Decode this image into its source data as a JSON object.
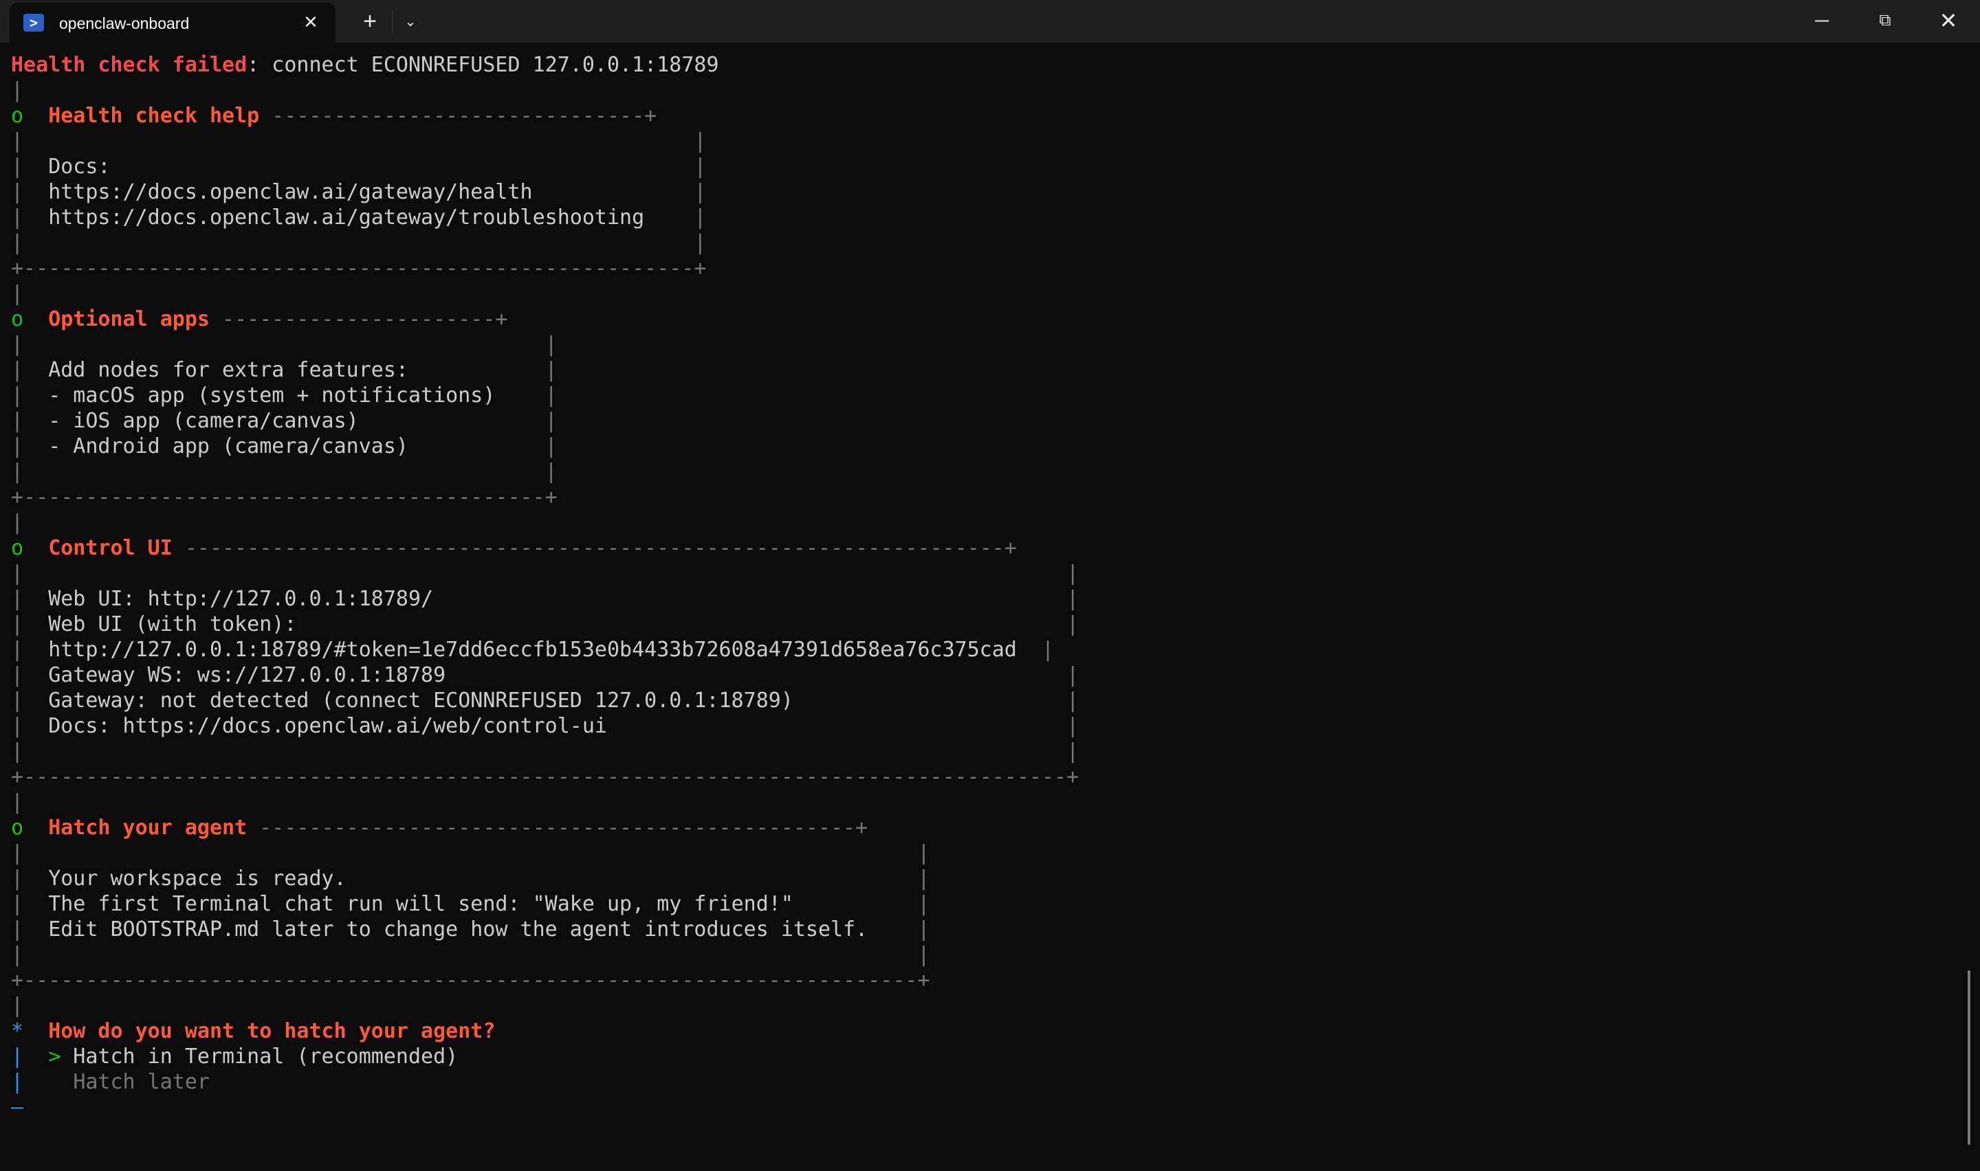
{
  "window": {
    "tab_title": "openclaw-onboard",
    "tab_icon": "powershell-icon",
    "new_tab_glyph": "+",
    "controls": [
      "minimize",
      "maximize",
      "close"
    ]
  },
  "terminal": {
    "lines": [
      [
        {
          "t": "Health check failed",
          "c": "red"
        },
        {
          "t": ": connect ECONNREFUSED 127.0.0.1:18789",
          "c": "white"
        }
      ],
      [
        {
          "t": "|",
          "c": "gray"
        }
      ],
      [
        {
          "t": "o",
          "c": "grn"
        },
        {
          "t": "  ",
          "c": "white"
        },
        {
          "t": "Health check help",
          "c": "orange"
        },
        {
          "t": " ------------------------------+",
          "c": "gray"
        }
      ],
      [
        {
          "t": "|                                                      |",
          "c": "gray"
        }
      ],
      [
        {
          "t": "|  ",
          "c": "gray"
        },
        {
          "t": "Docs:                                               ",
          "c": "white"
        },
        {
          "t": "|",
          "c": "gray"
        }
      ],
      [
        {
          "t": "|  ",
          "c": "gray"
        },
        {
          "t": "https://docs.openclaw.ai/gateway/health             ",
          "c": "white"
        },
        {
          "t": "|",
          "c": "gray"
        }
      ],
      [
        {
          "t": "|  ",
          "c": "gray"
        },
        {
          "t": "https://docs.openclaw.ai/gateway/troubleshooting    ",
          "c": "white"
        },
        {
          "t": "|",
          "c": "gray"
        }
      ],
      [
        {
          "t": "|                                                      |",
          "c": "gray"
        }
      ],
      [
        {
          "t": "+------------------------------------------------------+",
          "c": "gray"
        }
      ],
      [
        {
          "t": "|",
          "c": "gray"
        }
      ],
      [
        {
          "t": "o",
          "c": "grn"
        },
        {
          "t": "  ",
          "c": "white"
        },
        {
          "t": "Optional apps",
          "c": "orange"
        },
        {
          "t": " ----------------------+",
          "c": "gray"
        }
      ],
      [
        {
          "t": "|                                          |",
          "c": "gray"
        }
      ],
      [
        {
          "t": "|  ",
          "c": "gray"
        },
        {
          "t": "Add nodes for extra features:           ",
          "c": "white"
        },
        {
          "t": "|",
          "c": "gray"
        }
      ],
      [
        {
          "t": "|  ",
          "c": "gray"
        },
        {
          "t": "- macOS app (system + notifications)    ",
          "c": "white"
        },
        {
          "t": "|",
          "c": "gray"
        }
      ],
      [
        {
          "t": "|  ",
          "c": "gray"
        },
        {
          "t": "- iOS app (camera/canvas)               ",
          "c": "white"
        },
        {
          "t": "|",
          "c": "gray"
        }
      ],
      [
        {
          "t": "|  ",
          "c": "gray"
        },
        {
          "t": "- Android app (camera/canvas)           ",
          "c": "white"
        },
        {
          "t": "|",
          "c": "gray"
        }
      ],
      [
        {
          "t": "|                                          |",
          "c": "gray"
        }
      ],
      [
        {
          "t": "+------------------------------------------+",
          "c": "gray"
        }
      ],
      [
        {
          "t": "|",
          "c": "gray"
        }
      ],
      [
        {
          "t": "o",
          "c": "grn"
        },
        {
          "t": "  ",
          "c": "white"
        },
        {
          "t": "Control UI",
          "c": "orange"
        },
        {
          "t": " ------------------------------------------------------------------+",
          "c": "gray"
        }
      ],
      [
        {
          "t": "|                                                                                    |",
          "c": "gray"
        }
      ],
      [
        {
          "t": "|  ",
          "c": "gray"
        },
        {
          "t": "Web UI: http://127.0.0.1:18789/                                                   ",
          "c": "white"
        },
        {
          "t": "|",
          "c": "gray"
        }
      ],
      [
        {
          "t": "|  ",
          "c": "gray"
        },
        {
          "t": "Web UI (with token):                                                              ",
          "c": "white"
        },
        {
          "t": "|",
          "c": "gray"
        }
      ],
      [
        {
          "t": "|  ",
          "c": "gray"
        },
        {
          "t": "http://127.0.0.1:18789/#token=1e7dd6eccfb153e0b4433b72608a47391d658ea76c375cad  ",
          "c": "white"
        },
        {
          "t": "|",
          "c": "gray"
        }
      ],
      [
        {
          "t": "|  ",
          "c": "gray"
        },
        {
          "t": "Gateway WS: ws://127.0.0.1:18789                                                  ",
          "c": "white"
        },
        {
          "t": "|",
          "c": "gray"
        }
      ],
      [
        {
          "t": "|  ",
          "c": "gray"
        },
        {
          "t": "Gateway: not detected (connect ECONNREFUSED 127.0.0.1:18789)                      ",
          "c": "white"
        },
        {
          "t": "|",
          "c": "gray"
        }
      ],
      [
        {
          "t": "|  ",
          "c": "gray"
        },
        {
          "t": "Docs: https://docs.openclaw.ai/web/control-ui                                     ",
          "c": "white"
        },
        {
          "t": "|",
          "c": "gray"
        }
      ],
      [
        {
          "t": "|                                                                                    |",
          "c": "gray"
        }
      ],
      [
        {
          "t": "+------------------------------------------------------------------------------------+",
          "c": "gray"
        }
      ],
      [
        {
          "t": "|",
          "c": "gray"
        }
      ],
      [
        {
          "t": "o",
          "c": "grn"
        },
        {
          "t": "  ",
          "c": "white"
        },
        {
          "t": "Hatch your agent",
          "c": "orange"
        },
        {
          "t": " ------------------------------------------------+",
          "c": "gray"
        }
      ],
      [
        {
          "t": "|                                                                        |",
          "c": "gray"
        }
      ],
      [
        {
          "t": "|  ",
          "c": "gray"
        },
        {
          "t": "Your workspace is ready.                                              ",
          "c": "white"
        },
        {
          "t": "|",
          "c": "gray"
        }
      ],
      [
        {
          "t": "|  ",
          "c": "gray"
        },
        {
          "t": "The first Terminal chat run will send: \"Wake up, my friend!\"          ",
          "c": "white"
        },
        {
          "t": "|",
          "c": "gray"
        }
      ],
      [
        {
          "t": "|  ",
          "c": "gray"
        },
        {
          "t": "Edit BOOTSTRAP.md later to change how the agent introduces itself.    ",
          "c": "white"
        },
        {
          "t": "|",
          "c": "gray"
        }
      ],
      [
        {
          "t": "|                                                                        |",
          "c": "gray"
        }
      ],
      [
        {
          "t": "+------------------------------------------------------------------------+",
          "c": "gray"
        }
      ],
      [
        {
          "t": "|",
          "c": "gray"
        }
      ],
      [
        {
          "t": "*",
          "c": "blue"
        },
        {
          "t": "  ",
          "c": "white"
        },
        {
          "t": "How do you want to hatch your agent?",
          "c": "orange"
        }
      ],
      [
        {
          "t": "|",
          "c": "blue"
        },
        {
          "t": "  ",
          "c": "white"
        },
        {
          "t": ">",
          "c": "grn"
        },
        {
          "t": " Hatch in Terminal (recommended)",
          "c": "white"
        }
      ],
      [
        {
          "t": "|",
          "c": "blue"
        },
        {
          "t": "    ",
          "c": "white"
        },
        {
          "t": "Hatch later",
          "c": "dim"
        }
      ],
      [
        {
          "t": "—",
          "c": "blue"
        }
      ]
    ]
  }
}
